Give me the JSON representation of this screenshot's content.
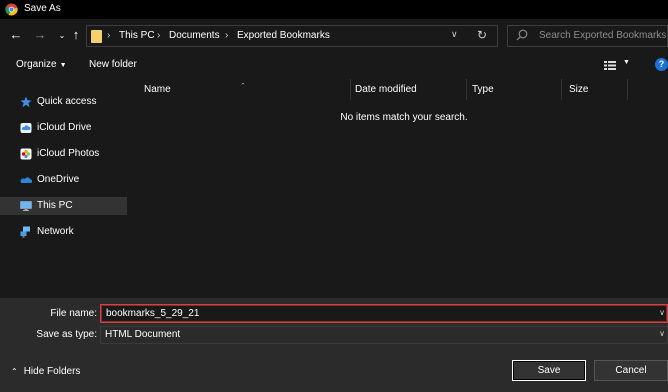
{
  "window": {
    "title": "Save As"
  },
  "address": {
    "crumbs": [
      "This PC",
      "Documents",
      "Exported Bookmarks"
    ],
    "search_placeholder": "Search Exported Bookmarks"
  },
  "toolbar": {
    "organize_label": "Organize",
    "new_folder_label": "New folder",
    "help_label": "?"
  },
  "nav": {
    "items": [
      {
        "label": "Quick access",
        "icon": "star-icon"
      },
      {
        "label": "iCloud Drive",
        "icon": "icloud-drive-icon"
      },
      {
        "label": "iCloud Photos",
        "icon": "icloud-photos-icon"
      },
      {
        "label": "OneDrive",
        "icon": "onedrive-cloud-icon"
      },
      {
        "label": "This PC",
        "icon": "monitor-icon",
        "selected": true
      },
      {
        "label": "Network",
        "icon": "network-icon"
      }
    ]
  },
  "file_list": {
    "columns": [
      "Name",
      "Date modified",
      "Type",
      "Size"
    ],
    "empty_message": "No items match your search."
  },
  "form": {
    "filename_label": "File name:",
    "filename_value": "bookmarks_5_29_21",
    "savetype_label": "Save as type:",
    "savetype_value": "HTML Document"
  },
  "footer": {
    "hide_folders_label": "Hide Folders",
    "save_label": "Save",
    "cancel_label": "Cancel"
  },
  "colors": {
    "accent_focus": "#cc4444",
    "folder": "#f4d06f",
    "help": "#1a73d9"
  }
}
